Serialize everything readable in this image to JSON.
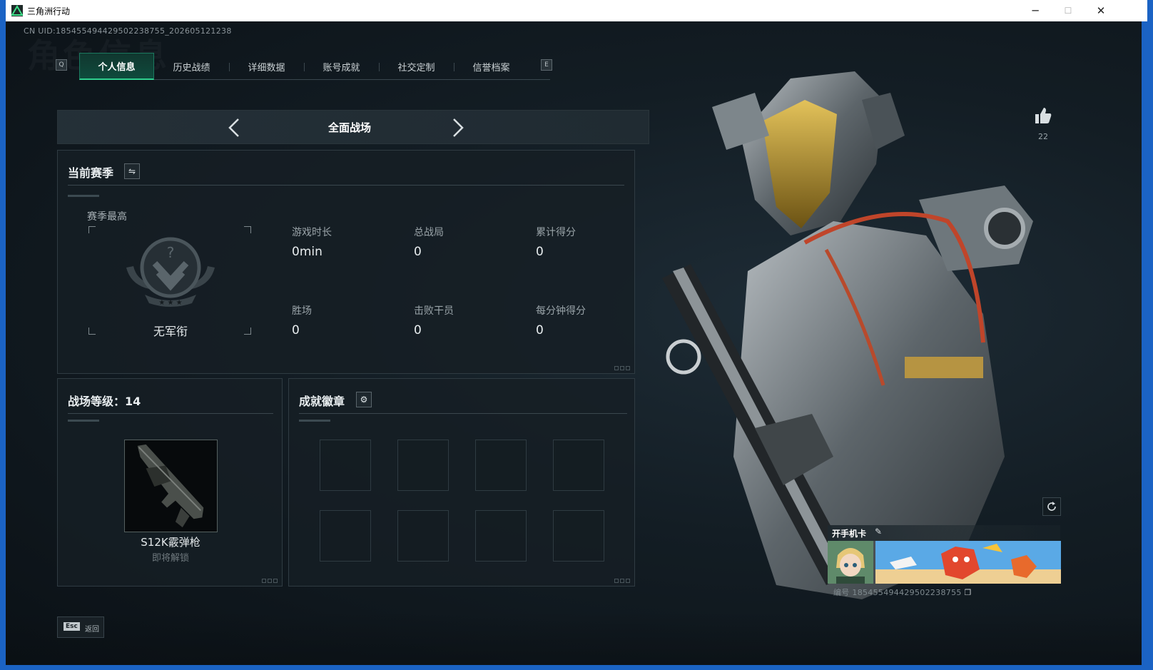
{
  "window": {
    "title": "三角洲行动",
    "minimize": "─",
    "maximize": "☐",
    "close": "✕"
  },
  "header": {
    "uid": "CN UID:18545549442950223875​5_202605121238",
    "bg_title": "角色信息"
  },
  "tabs": {
    "left_key": "Q",
    "right_key": "E",
    "items": [
      {
        "label": "个人信息",
        "active": true
      },
      {
        "label": "历史战绩",
        "active": false
      },
      {
        "label": "详细数据",
        "active": false
      },
      {
        "label": "账号成就",
        "active": false
      },
      {
        "label": "社交定制",
        "active": false
      },
      {
        "label": "信誉档案",
        "active": false
      }
    ]
  },
  "mode": {
    "label": "全面战场"
  },
  "season": {
    "title": "当前赛季",
    "highest_label": "赛季最高",
    "rank_name": "无军衔",
    "stats": [
      {
        "label": "游戏时长",
        "value": "0min"
      },
      {
        "label": "总战局",
        "value": "0"
      },
      {
        "label": "累计得分",
        "value": "0"
      },
      {
        "label": "胜场",
        "value": "0"
      },
      {
        "label": "击败干员",
        "value": "0"
      },
      {
        "label": "每分钟得分",
        "value": "0"
      }
    ]
  },
  "level": {
    "title": "战场等级：14",
    "weapon_name": "S12K霰弹枪",
    "weapon_status": "即将解锁"
  },
  "badges": {
    "title": "成就徽章",
    "slots": 8
  },
  "likes": {
    "count": "22"
  },
  "card": {
    "title": "开手机卡",
    "id_text": "编号 18545549442950223875​5"
  },
  "footer": {
    "esc_key": "Esc",
    "esc_label": "返回"
  },
  "colors": {
    "accent": "#2fd08e",
    "tab_active_bg": "#0f4a3c",
    "panel_bg": "#161f25"
  }
}
